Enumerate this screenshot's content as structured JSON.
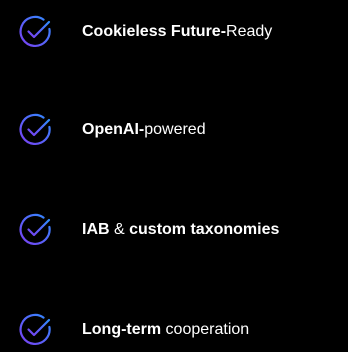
{
  "features": [
    {
      "icon": "check-circle-icon",
      "parts": [
        {
          "text": "Cookieless Future-",
          "bold": true
        },
        {
          "text": "Ready",
          "bold": false
        }
      ]
    },
    {
      "icon": "check-circle-icon",
      "parts": [
        {
          "text": "OpenAI-",
          "bold": true
        },
        {
          "text": "powered",
          "bold": false
        }
      ]
    },
    {
      "icon": "check-circle-icon",
      "parts": [
        {
          "text": "IAB",
          "bold": true
        },
        {
          "text": " & ",
          "bold": false
        },
        {
          "text": "custom taxonomies",
          "bold": true
        }
      ]
    },
    {
      "icon": "check-circle-icon",
      "parts": [
        {
          "text": "Long-term",
          "bold": true
        },
        {
          "text": " cooperation",
          "bold": false
        }
      ]
    }
  ],
  "colors": {
    "background": "#000000",
    "text": "#ffffff",
    "icon_gradient_start": "#7b3ff2",
    "icon_gradient_end": "#2f8cff"
  }
}
